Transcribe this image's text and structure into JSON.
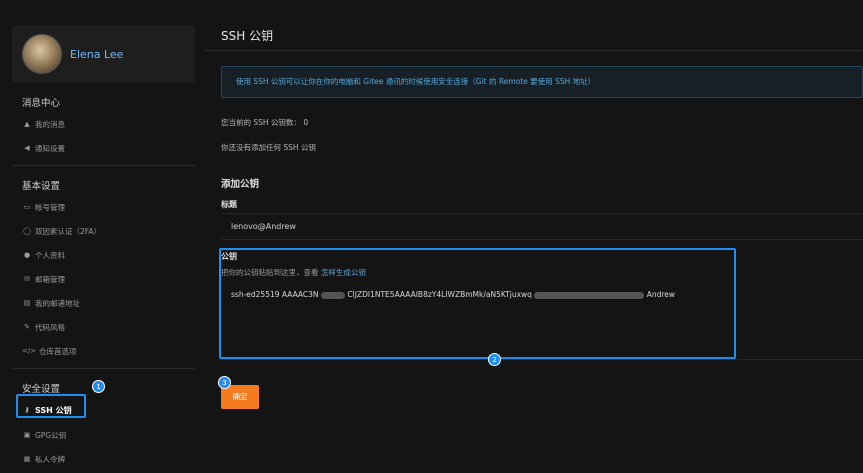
{
  "sidebar": {
    "user_name": "Elena Lee",
    "sections": [
      {
        "title": "消息中心",
        "items": [
          {
            "icon": "bell-icon",
            "glyph": "🔔",
            "label": "我的消息"
          },
          {
            "icon": "volume-icon",
            "glyph": "◀",
            "label": "通知设置"
          }
        ]
      },
      {
        "title": "基本设置",
        "items": [
          {
            "icon": "id-card-icon",
            "glyph": "▭",
            "label": "帐号管理"
          },
          {
            "icon": "shield-user-icon",
            "glyph": "⛨",
            "label": "双因素认证（2FA）"
          },
          {
            "icon": "user-icon",
            "glyph": "●",
            "label": "个人资料"
          },
          {
            "icon": "mail-icon",
            "glyph": "✉",
            "label": "邮箱管理"
          },
          {
            "icon": "address-icon",
            "glyph": "▤",
            "label": "我的邮递地址"
          },
          {
            "icon": "brush-icon",
            "glyph": "✎",
            "label": "代码风格"
          },
          {
            "icon": "code-icon",
            "glyph": "</>",
            "label": "仓库首选项"
          }
        ]
      },
      {
        "title": "安全设置",
        "items": [
          {
            "icon": "key-icon",
            "glyph": "⚷",
            "label": "SSH 公钥"
          },
          {
            "icon": "lock-icon",
            "glyph": "🔒",
            "label": "GPG公钥"
          },
          {
            "icon": "token-icon",
            "glyph": "▦",
            "label": "私人令牌"
          }
        ]
      }
    ]
  },
  "main": {
    "title": "SSH 公钥",
    "info": "使用 SSH 公钥可以让你在你的电脑和 Gitee 通讯的时候使用安全连接（Git 的 Remote 要使用 SSH 地址）",
    "count_text": "您当前的 SSH 公钥数： 0",
    "empty_text": "你还没有添加任何 SSH 公钥",
    "add_title": "添加公钥",
    "label_title": "标题",
    "title_value": "lenovo@Andrew",
    "key_label": "公钥",
    "key_hint": "把你的公钥粘贴到这里，查看",
    "key_hint_link": "怎样生成公钥",
    "key_value_part1": "ssh-ed25519 AAAAC3N",
    "key_value_part2": "CIJZDI1NTE5AAAAIB8zY4LIWZBmMk/aN5KTjuxwq",
    "key_value_part3": "Andrew",
    "confirm_label": "确定"
  },
  "annotations": {
    "badge1": "1",
    "badge2": "2",
    "badge3": "3"
  },
  "colors": {
    "accent": "#1e8ff0",
    "button": "#f47b20",
    "link": "#5aa7d8"
  }
}
